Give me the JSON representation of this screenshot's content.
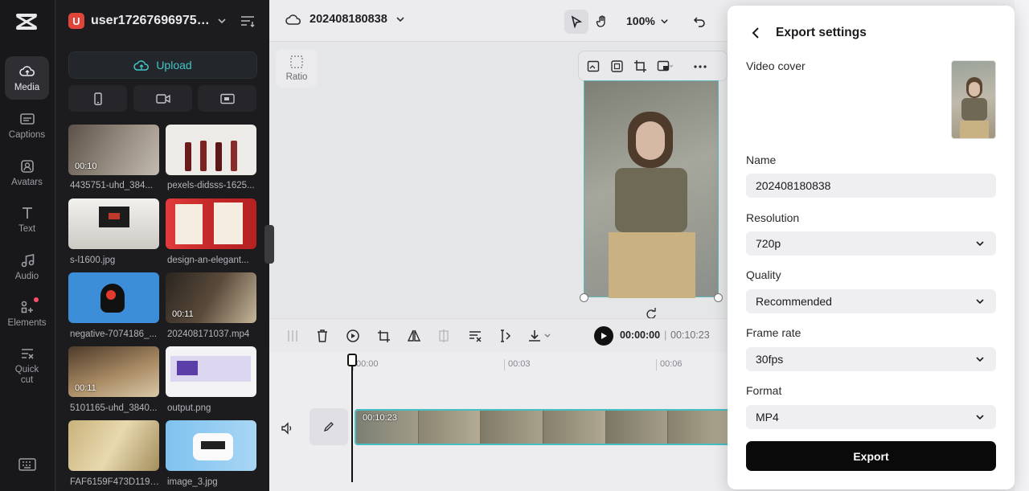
{
  "sidebar": {
    "items": [
      {
        "label": "Media",
        "icon": "cloud-icon",
        "active": true
      },
      {
        "label": "Captions",
        "icon": "captions-icon"
      },
      {
        "label": "Avatars",
        "icon": "avatar-icon"
      },
      {
        "label": "Text",
        "icon": "text-icon"
      },
      {
        "label": "Audio",
        "icon": "music-note-icon"
      },
      {
        "label": "Elements",
        "icon": "elements-icon"
      },
      {
        "label": "Quick cut",
        "icon": "quick-cut-icon"
      }
    ]
  },
  "panel": {
    "user": {
      "initial": "U",
      "name": "user172676969755..."
    },
    "upload_label": "Upload",
    "media": [
      {
        "label": "4435751-uhd_384...",
        "duration": "00:10"
      },
      {
        "label": "pexels-didsss-1625...",
        "duration": ""
      },
      {
        "label": "s-l1600.jpg",
        "duration": ""
      },
      {
        "label": "design-an-elegant...",
        "duration": ""
      },
      {
        "label": "negative-7074186_...",
        "duration": ""
      },
      {
        "label": "202408171037.mp4",
        "duration": "00:11"
      },
      {
        "label": "5101165-uhd_3840...",
        "duration": "00:11"
      },
      {
        "label": "output.png",
        "duration": ""
      },
      {
        "label": "FAF6159F473D1194...",
        "duration": ""
      },
      {
        "label": "image_3.jpg",
        "duration": ""
      }
    ]
  },
  "topbar": {
    "project_name": "202408180838",
    "zoom": "100%"
  },
  "canvas": {
    "ratio_label": "Ratio"
  },
  "timeline": {
    "current_time": "00:00:00",
    "total_time": "00:10:23",
    "ruler": [
      "00:00",
      "00:03",
      "00:06"
    ],
    "clip_duration": "00:10:23"
  },
  "export": {
    "title": "Export settings",
    "video_cover_label": "Video cover",
    "name_label": "Name",
    "name_value": "202408180838",
    "resolution_label": "Resolution",
    "resolution_value": "720p",
    "quality_label": "Quality",
    "quality_value": "Recommended",
    "framerate_label": "Frame rate",
    "framerate_value": "30fps",
    "format_label": "Format",
    "format_value": "MP4",
    "export_button": "Export"
  },
  "colors": {
    "accent": "#43c6c9",
    "rail": "#18181b",
    "panel": "#1c1c1f",
    "export_button": "#0a0a0a"
  }
}
